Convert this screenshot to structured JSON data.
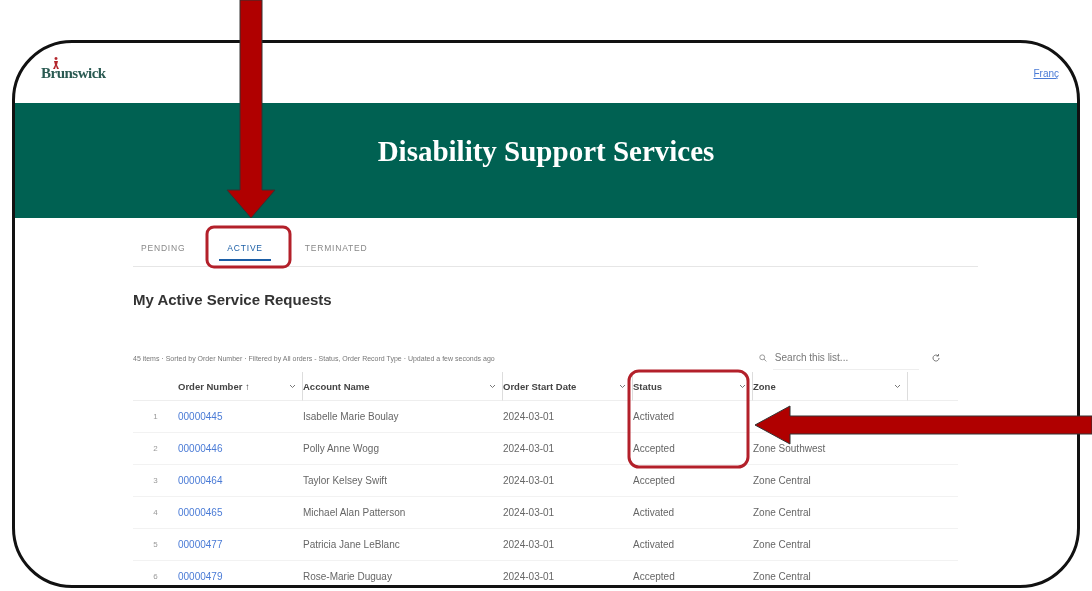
{
  "header": {
    "logo_text": "Brunswick",
    "link": "Franç"
  },
  "banner": {
    "title": "Disability Support Services"
  },
  "tabs": [
    {
      "label": "PENDING",
      "selected": false
    },
    {
      "label": "ACTIVE",
      "selected": true
    },
    {
      "label": "TERMINATED",
      "selected": false
    }
  ],
  "list": {
    "title": "My Active Service Requests",
    "info": "45 items · Sorted by Order Number · Filtered by All orders - Status, Order Record Type · Updated a few seconds ago",
    "search": {
      "placeholder": "Search this list..."
    },
    "columns": [
      {
        "label": "Order Number",
        "sort": "↑"
      },
      {
        "label": "Account Name"
      },
      {
        "label": "Order Start Date"
      },
      {
        "label": "Status"
      },
      {
        "label": "Zone"
      }
    ],
    "rows": [
      {
        "index": "1",
        "order": "00000445",
        "account": "Isabelle Marie Boulay",
        "date": "2024-03-01",
        "status": "Activated"
      },
      {
        "index": "2",
        "order": "00000446",
        "account": "Polly Anne Wogg",
        "date": "2024-03-01",
        "status": "Accepted",
        "zone": "Zone Southwest"
      },
      {
        "index": "3",
        "order": "00000464",
        "account": "Taylor Kelsey Swift",
        "date": "2024-03-01",
        "status": "Accepted",
        "zone": "Zone Central"
      },
      {
        "index": "4",
        "order": "00000465",
        "account": "Michael Alan Patterson",
        "date": "2024-03-01",
        "status": "Activated",
        "zone": "Zone Central"
      },
      {
        "index": "5",
        "order": "00000477",
        "account": "Patricia Jane LeBlanc",
        "date": "2024-03-01",
        "status": "Activated",
        "zone": "Zone Central"
      },
      {
        "index": "6",
        "order": "00000479",
        "account": "Rose-Marie Duguay",
        "date": "2024-03-01",
        "status": "Accepted",
        "zone": "Zone Central"
      }
    ]
  }
}
